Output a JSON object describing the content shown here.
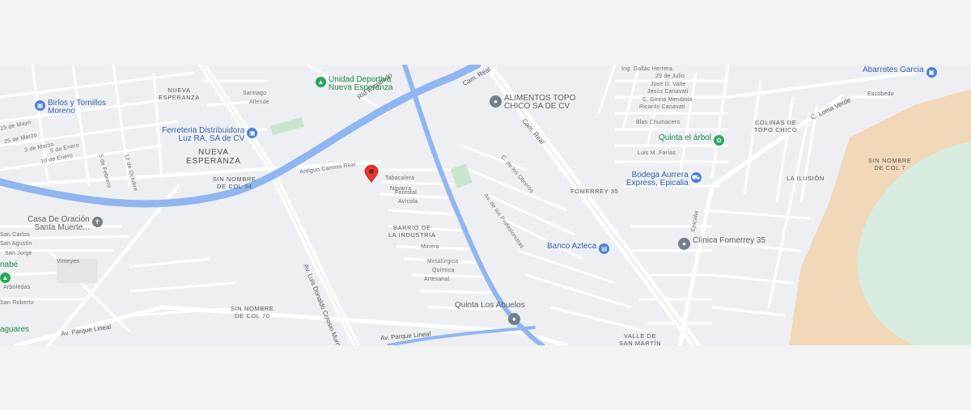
{
  "map": {
    "pois": [
      {
        "id": "unidad",
        "lines": [
          "Unidad Deportiva",
          "Nueva Esperanza"
        ],
        "kind": "green",
        "icon": "park-icon"
      },
      {
        "id": "birlos",
        "lines": [
          "Birlos y Tornillos",
          "Moreno"
        ],
        "kind": "blue",
        "icon": "shopping-icon"
      },
      {
        "id": "ferreteria",
        "lines": [
          "Ferreteria Distribuidora",
          "Luz RA, SA de CV"
        ],
        "kind": "blue",
        "icon": "shopping-icon"
      },
      {
        "id": "alimentos",
        "lines": [
          "ALIMENTOS TOPO",
          "CHICO SA DE CV"
        ],
        "kind": "gray",
        "icon": "place-icon"
      },
      {
        "id": "abarrotes",
        "lines": [
          "Abarrotes Garcia"
        ],
        "kind": "blue",
        "icon": "shopping-icon"
      },
      {
        "id": "quintaarbol",
        "lines": [
          "Quinta el árbol"
        ],
        "kind": "green",
        "icon": "event-icon"
      },
      {
        "id": "bodega",
        "lines": [
          "Bodega Aurrera",
          "Express, Epicalia"
        ],
        "kind": "blue",
        "icon": "cart-icon"
      },
      {
        "id": "casa",
        "lines": [
          "Casa De Oración",
          "Santa Muerte..."
        ],
        "kind": "gray",
        "icon": "church-icon"
      },
      {
        "id": "banco",
        "lines": [
          "Banco Azteca"
        ],
        "kind": "blue",
        "icon": "bank-icon"
      },
      {
        "id": "clinica",
        "lines": [
          "Clínica Fomerrey 35"
        ],
        "kind": "gray",
        "icon": "place-icon"
      },
      {
        "id": "quintaabuelos",
        "lines": [
          "Quinta Los Abuelos"
        ],
        "kind": "gray",
        "icon": "place-icon"
      },
      {
        "id": "anabe",
        "lines": [
          "nabé"
        ],
        "kind": "green",
        "icon": "park-icon"
      },
      {
        "id": "aguares",
        "lines": [
          "aguares"
        ],
        "kind": "green",
        "icon": "park-icon"
      }
    ],
    "areas": [
      {
        "id": "nueva1",
        "text": "NUEVA\nESPERANZA"
      },
      {
        "id": "nueva2",
        "text": "NUEVA\nESPERANZA"
      },
      {
        "id": "snc34",
        "text": "SIN NOMBRE\nDE COL 34"
      },
      {
        "id": "barrio",
        "text": "BARRIO DE\nLA INDUSTRIA"
      },
      {
        "id": "snc70",
        "text": "SIN NOMBRE\nDE COL 70"
      },
      {
        "id": "fomerrey",
        "text": "FOMERREY 35"
      },
      {
        "id": "colinas",
        "text": "COLINAS DE\nTOPO CHICO"
      },
      {
        "id": "ilusion",
        "text": "LA ILUSIÓN"
      },
      {
        "id": "snc7",
        "text": "SIN NOMBRE\nDE COL 7"
      },
      {
        "id": "valle",
        "text": "VALLE DE\nSAN MARTÍN"
      }
    ],
    "streets": {
      "santiago": "Santiago",
      "allende": "Allende",
      "mayo15": "15 de Mayo",
      "marzo25": "25 de Marzo",
      "marzo3": "3 de Marzo",
      "enero5": "5 de Enero",
      "enero10": "10 de Enero",
      "febrero": "5 de Febrero",
      "octubre": "12 de Octubre",
      "tabacalera": "Tabacalera",
      "navarra": "Navarra",
      "forestal": "Forestal",
      "avicola": "Avícola",
      "minera": "Minera",
      "metalurgica": "Metalúrgica",
      "quimica": "Química",
      "artesanal": "Artesanal",
      "carlos": "San Carlos",
      "agustin": "San Agustin",
      "jorge": "San Jorge",
      "arboledas": "Arboledas",
      "roberto": "San Roberto",
      "vimeyes": "Vimeyes",
      "gallardo": "Ing. Gallac Herrera",
      "julio": "29 de Julio",
      "valle": "José D. Valle",
      "canavati": "Jesús Canavati",
      "gloria": "C. Gloria Mendiola",
      "ricardo": "Ricardo Canavati",
      "blas": "Blas Chumacero",
      "luis": "Luis M. Farías",
      "escobedo": "Escobedo",
      "lomaverde": "C. Loma Verde",
      "camreal1": "Cam. Real",
      "camreal2": "Cam. Real",
      "rioesc": "Río Escobedo",
      "avluis": "Av. Luis Donaldo Colosio Murrieta",
      "avparque": "Av. Parque Lineal",
      "avparque2": "Av. Parque Lineal",
      "camreal3": "Antiguo Camino Real",
      "epicalia": "Epicalia",
      "profesionistas": "Av. de los Profesionistas",
      "obreros": "C. de los Obreros"
    }
  }
}
